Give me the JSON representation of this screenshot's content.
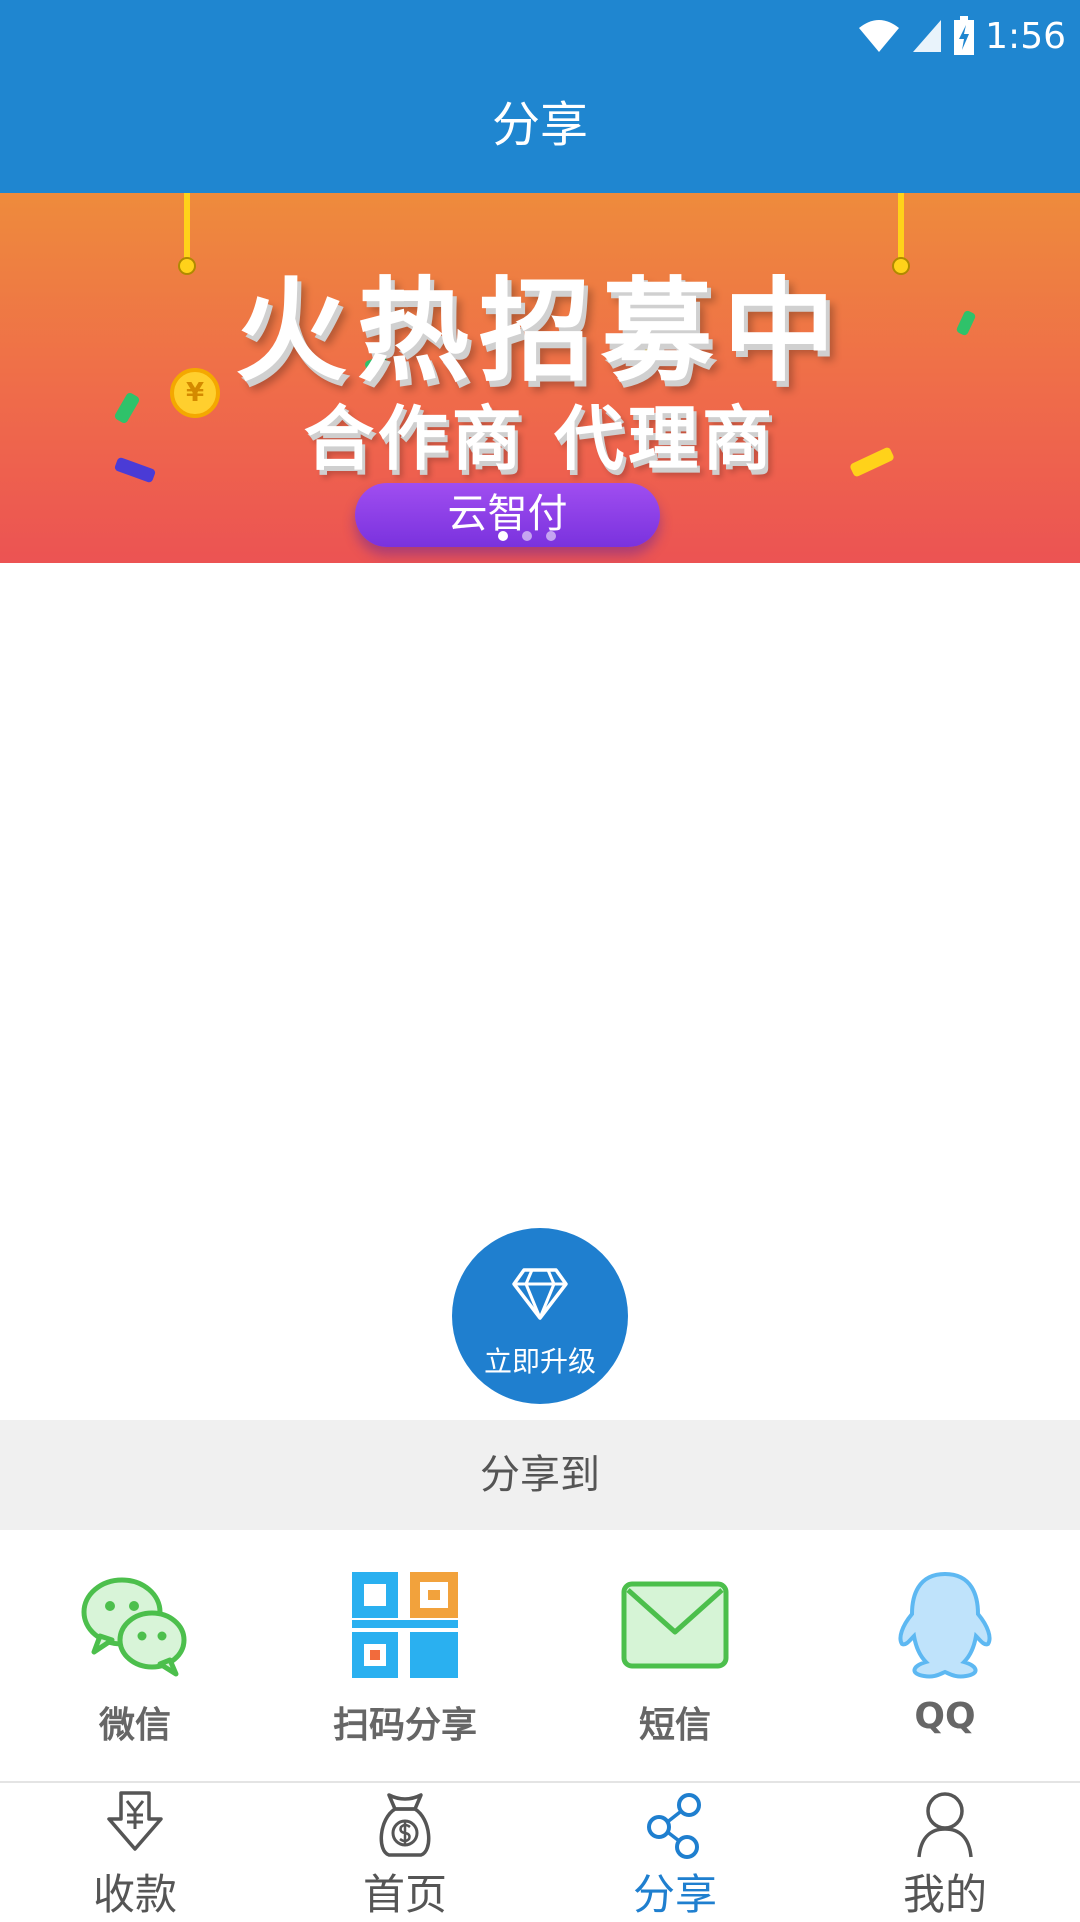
{
  "status_bar": {
    "time": "1:56"
  },
  "header": {
    "title": "分享"
  },
  "banner": {
    "headline": "火热招募中",
    "subtitle": "合作商 代理商",
    "badge": "云智付",
    "coin_symbol": "¥"
  },
  "upgrade": {
    "label": "立即升级"
  },
  "share": {
    "heading": "分享到",
    "options": [
      {
        "label": "微信",
        "icon": "wechat-icon"
      },
      {
        "label": "扫码分享",
        "icon": "qr-code-icon"
      },
      {
        "label": "短信",
        "icon": "sms-icon"
      },
      {
        "label": "QQ",
        "icon": "qq-icon"
      }
    ]
  },
  "bottom_nav": {
    "tabs": [
      {
        "label": "收款",
        "icon": "collect-payment-icon",
        "active": false
      },
      {
        "label": "首页",
        "icon": "money-bag-icon",
        "active": false
      },
      {
        "label": "分享",
        "icon": "share-icon",
        "active": true
      },
      {
        "label": "我的",
        "icon": "user-icon",
        "active": false
      }
    ]
  },
  "colors": {
    "primary": "#1f86d0",
    "active_tab": "#1f7fcf",
    "banner_top": "#ee8b3c",
    "banner_bottom": "#ec5353"
  }
}
